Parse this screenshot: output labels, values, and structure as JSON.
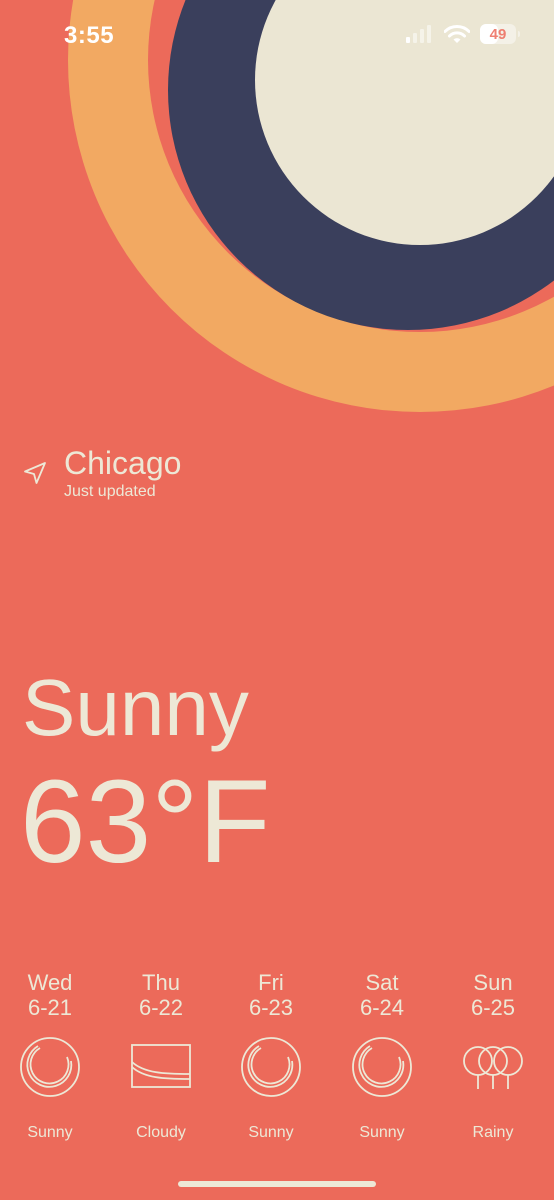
{
  "status_bar": {
    "time": "3:55",
    "battery": "49",
    "battery_level": 0.49,
    "icons": [
      "cellular-signal-icon",
      "wifi-icon",
      "battery-icon"
    ]
  },
  "location": {
    "icon": "location-arrow-icon",
    "city": "Chicago",
    "updated": "Just updated"
  },
  "current": {
    "condition": "Sunny",
    "temperature": "63°F"
  },
  "forecast": [
    {
      "day": "Wed",
      "date": "6-21",
      "condition": "Sunny",
      "icon": "sunny-icon"
    },
    {
      "day": "Thu",
      "date": "6-22",
      "condition": "Cloudy",
      "icon": "cloudy-icon"
    },
    {
      "day": "Fri",
      "date": "6-23",
      "condition": "Sunny",
      "icon": "sunny-icon"
    },
    {
      "day": "Sat",
      "date": "6-24",
      "condition": "Sunny",
      "icon": "sunny-icon"
    },
    {
      "day": "Sun",
      "date": "6-25",
      "condition": "Rainy",
      "icon": "rainy-icon"
    }
  ],
  "colors": {
    "background": "#EC6A5A",
    "outer_ring": "#F2A962",
    "dark_ring": "#3A3F5C",
    "sun": "#EBE6D3",
    "text": "#EDE8D6"
  }
}
